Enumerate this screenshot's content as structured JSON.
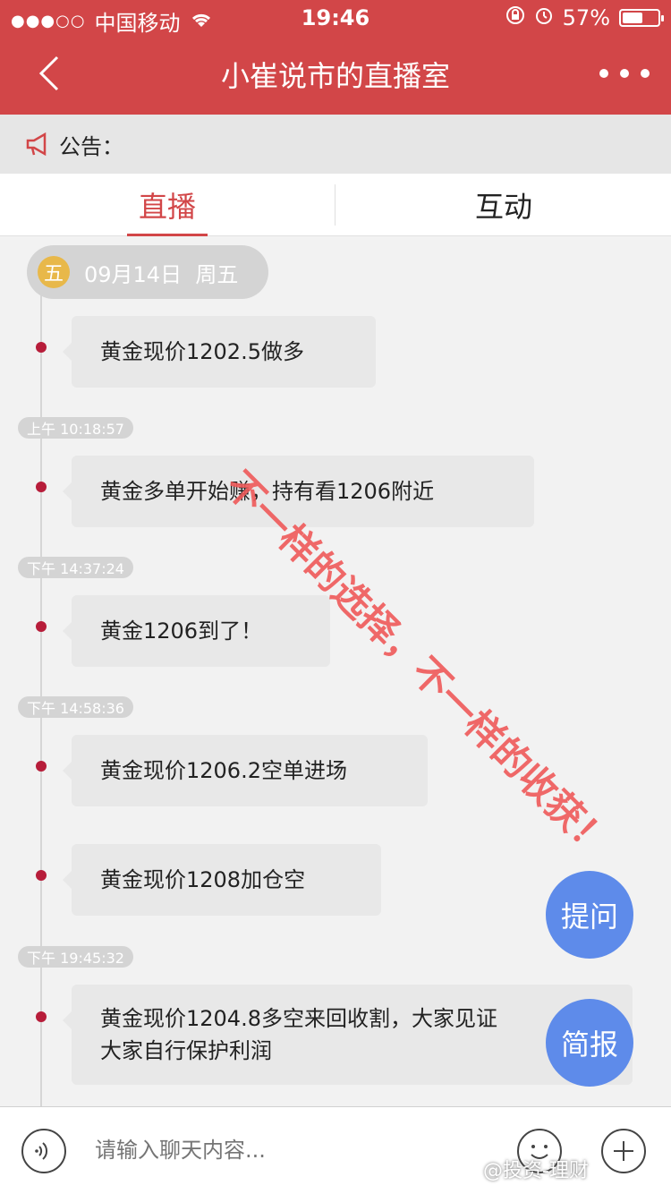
{
  "status_bar": {
    "signal": "●●●○○",
    "carrier": "中国移动",
    "wifi_icon": "wifi-icon",
    "time": "19:46",
    "battery_percent": "57%",
    "battery_level": 0.57
  },
  "nav": {
    "title": "小崔说市的直播室",
    "back_icon": "chevron-left-icon",
    "more_icon": "more-dots-icon"
  },
  "notice": {
    "label": "公告："
  },
  "tabs": [
    {
      "label": "直播",
      "active": true
    },
    {
      "label": "互动",
      "active": false
    }
  ],
  "date_header": {
    "weekday_short": "五",
    "date": "09月14日",
    "weekday": "周五"
  },
  "messages": [
    {
      "time": "",
      "text": "黄金现价1202.5做多"
    },
    {
      "time": "上午 10:18:57",
      "text": "黄金多单开始赚，持有看1206附近"
    },
    {
      "time": "下午 14:37:24",
      "text": "黄金1206到了！"
    },
    {
      "time": "下午 14:58:36",
      "text": "黄金现价1206.2空单进场"
    },
    {
      "time": "",
      "text": "黄金现价1208加仓空"
    },
    {
      "time": "下午 19:45:32",
      "text": "黄金现价1204.8多空来回收割，大家见证"
    },
    {
      "time": "",
      "text": "大家自行保护利润"
    }
  ],
  "fabs": {
    "ask": "提问",
    "brief": "简报"
  },
  "input_bar": {
    "placeholder": "请输入聊天内容..."
  },
  "watermark": "不一样的选择，不一样的收获！",
  "credit": "@投资-理财",
  "colors": {
    "brand": "#d24648",
    "fab": "#5e8bea",
    "timeline_dot": "#b71d3a"
  }
}
